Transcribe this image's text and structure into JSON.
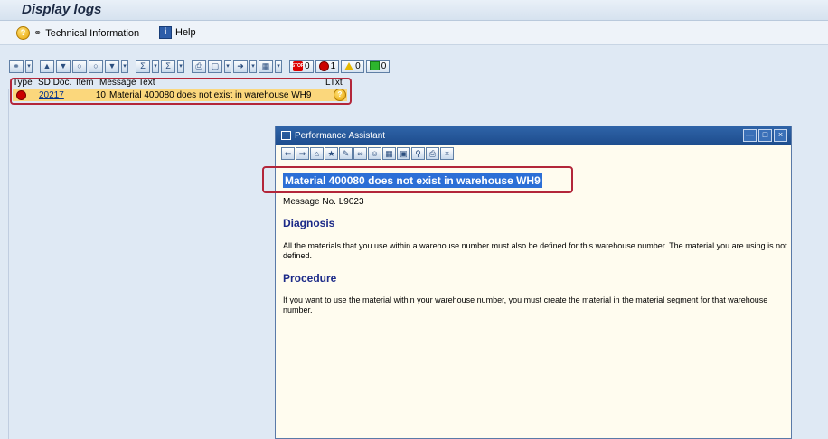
{
  "window": {
    "title": "Display logs"
  },
  "menu": {
    "technical_information": "Technical Information",
    "help": "Help"
  },
  "toolbar": {
    "icons": [
      "technical-icon",
      "filter-icon",
      "sort-asc-icon",
      "sort-desc-icon",
      "find-icon",
      "find-next-icon",
      "filter-set-icon",
      "sum-icon",
      "subtotal-icon",
      "print-icon",
      "view-icon",
      "export-icon",
      "layout-icon"
    ],
    "counts": {
      "stop": "0",
      "error": "1",
      "warning": "0",
      "success": "0"
    }
  },
  "log_table": {
    "columns": [
      "Type",
      "SD Doc.",
      "Item",
      "Message Text",
      "LTxt"
    ],
    "rows": [
      {
        "type": "error",
        "sd_doc": "20217",
        "item": "10",
        "message": "Material 400080 does not exist in warehouse WH9",
        "ltxt": "?"
      }
    ]
  },
  "performance_assistant": {
    "title": "Performance Assistant",
    "heading": "Material 400080 does not exist in warehouse WH9",
    "message_no": "Message No. L9023",
    "diagnosis_title": "Diagnosis",
    "diagnosis_text": "All the materials that you use within a warehouse number must also be defined for this warehouse number.  The material you are using is not defined.",
    "procedure_title": "Procedure",
    "procedure_text": "If you want to use the material within your warehouse number, you must create the material in the material segment for that warehouse number."
  },
  "colors": {
    "accent": "#2c6fd6",
    "row_highlight": "#fbd77c",
    "annotation": "#b3263a"
  }
}
